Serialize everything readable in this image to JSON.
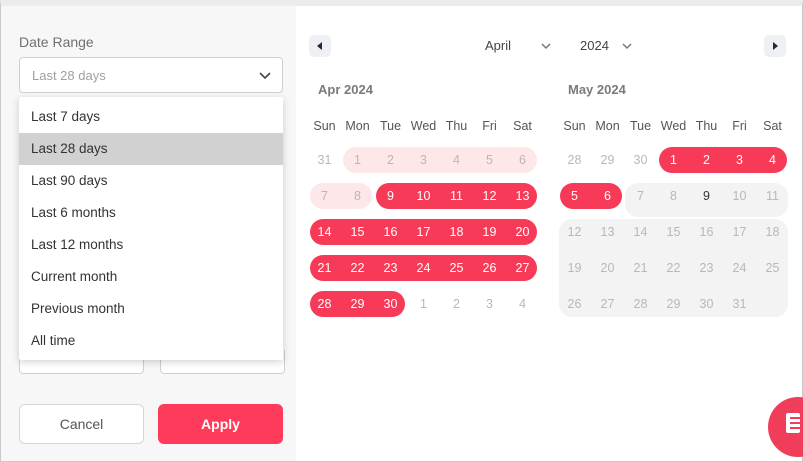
{
  "filter": {
    "label": "Date Range",
    "placeholder": "Last 28 days",
    "options": [
      {
        "label": "Last 7 days",
        "selected": false
      },
      {
        "label": "Last 28 days",
        "selected": true
      },
      {
        "label": "Last 90 days",
        "selected": false
      },
      {
        "label": "Last 6 months",
        "selected": false
      },
      {
        "label": "Last 12 months",
        "selected": false
      },
      {
        "label": "Current month",
        "selected": false
      },
      {
        "label": "Previous month",
        "selected": false
      },
      {
        "label": "All time",
        "selected": false
      }
    ]
  },
  "actions": {
    "cancel": "Cancel",
    "apply": "Apply"
  },
  "calendar_nav": {
    "month": "April",
    "year": "2024",
    "prev_icon": "caret-left-icon",
    "next_icon": "caret-right-icon"
  },
  "weekdays": [
    "Sun",
    "Mon",
    "Tue",
    "Wed",
    "Thu",
    "Fri",
    "Sat"
  ],
  "months": [
    {
      "title": "Apr 2024",
      "weeks": [
        [
          {
            "d": "31",
            "s": "muted"
          },
          {
            "d": "1",
            "s": "in-range"
          },
          {
            "d": "2",
            "s": "in-range"
          },
          {
            "d": "3",
            "s": "in-range"
          },
          {
            "d": "4",
            "s": "in-range"
          },
          {
            "d": "5",
            "s": "in-range"
          },
          {
            "d": "6",
            "s": "in-range"
          }
        ],
        [
          {
            "d": "7",
            "s": "in-range"
          },
          {
            "d": "8",
            "s": "in-range"
          },
          {
            "d": "9",
            "s": "selected"
          },
          {
            "d": "10",
            "s": "selected"
          },
          {
            "d": "11",
            "s": "selected"
          },
          {
            "d": "12",
            "s": "selected"
          },
          {
            "d": "13",
            "s": "selected"
          }
        ],
        [
          {
            "d": "14",
            "s": "selected"
          },
          {
            "d": "15",
            "s": "selected"
          },
          {
            "d": "16",
            "s": "selected"
          },
          {
            "d": "17",
            "s": "selected"
          },
          {
            "d": "18",
            "s": "selected"
          },
          {
            "d": "19",
            "s": "selected"
          },
          {
            "d": "20",
            "s": "selected"
          }
        ],
        [
          {
            "d": "21",
            "s": "selected"
          },
          {
            "d": "22",
            "s": "selected"
          },
          {
            "d": "23",
            "s": "selected"
          },
          {
            "d": "24",
            "s": "selected"
          },
          {
            "d": "25",
            "s": "selected"
          },
          {
            "d": "26",
            "s": "selected"
          },
          {
            "d": "27",
            "s": "selected"
          }
        ],
        [
          {
            "d": "28",
            "s": "selected"
          },
          {
            "d": "29",
            "s": "selected"
          },
          {
            "d": "30",
            "s": "selected"
          },
          {
            "d": "1",
            "s": "muted"
          },
          {
            "d": "2",
            "s": "muted"
          },
          {
            "d": "3",
            "s": "muted"
          },
          {
            "d": "4",
            "s": "muted"
          }
        ]
      ]
    },
    {
      "title": "May 2024",
      "weeks": [
        [
          {
            "d": "28",
            "s": "muted"
          },
          {
            "d": "29",
            "s": "muted"
          },
          {
            "d": "30",
            "s": "muted"
          },
          {
            "d": "1",
            "s": "selected"
          },
          {
            "d": "2",
            "s": "selected"
          },
          {
            "d": "3",
            "s": "selected"
          },
          {
            "d": "4",
            "s": "selected"
          }
        ],
        [
          {
            "d": "5",
            "s": "selected"
          },
          {
            "d": "6",
            "s": "selected"
          },
          {
            "d": "7",
            "s": "disabled"
          },
          {
            "d": "8",
            "s": "disabled"
          },
          {
            "d": "9",
            "s": "today"
          },
          {
            "d": "10",
            "s": "disabled"
          },
          {
            "d": "11",
            "s": "disabled"
          }
        ],
        [
          {
            "d": "12",
            "s": "disabled"
          },
          {
            "d": "13",
            "s": "disabled"
          },
          {
            "d": "14",
            "s": "disabled"
          },
          {
            "d": "15",
            "s": "disabled"
          },
          {
            "d": "16",
            "s": "disabled"
          },
          {
            "d": "17",
            "s": "disabled"
          },
          {
            "d": "18",
            "s": "disabled"
          }
        ],
        [
          {
            "d": "19",
            "s": "disabled"
          },
          {
            "d": "20",
            "s": "disabled"
          },
          {
            "d": "21",
            "s": "disabled"
          },
          {
            "d": "22",
            "s": "disabled"
          },
          {
            "d": "23",
            "s": "disabled"
          },
          {
            "d": "24",
            "s": "disabled"
          },
          {
            "d": "25",
            "s": "disabled"
          }
        ],
        [
          {
            "d": "26",
            "s": "disabled"
          },
          {
            "d": "27",
            "s": "disabled"
          },
          {
            "d": "28",
            "s": "disabled"
          },
          {
            "d": "29",
            "s": "disabled"
          },
          {
            "d": "30",
            "s": "disabled"
          },
          {
            "d": "31",
            "s": "disabled"
          },
          {
            "d": "",
            "s": "disabled"
          }
        ]
      ]
    }
  ],
  "colors": {
    "accent": "#ff3b5c",
    "range_fill": "#f63a58",
    "range_light": "#fde7e9",
    "disabled_fill": "#f3f3f3"
  },
  "corner_widget_icon": "document-icon"
}
